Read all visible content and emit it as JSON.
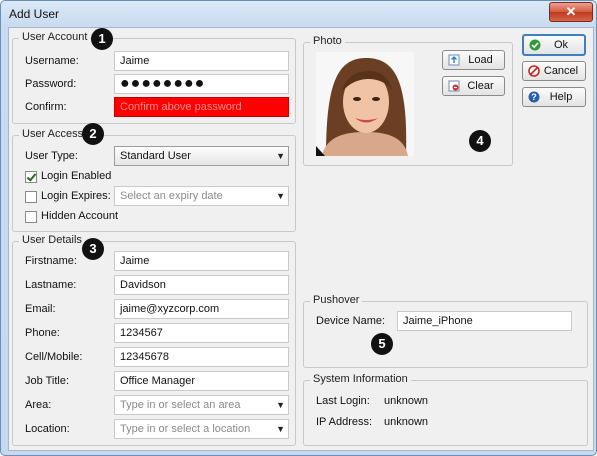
{
  "window": {
    "title": "Add User",
    "close_glyph": "✕"
  },
  "user_account": {
    "legend": "User Account",
    "username_label": "Username:",
    "username_value": "Jaime",
    "password_label": "Password:",
    "password_value": "●●●●●●●●",
    "confirm_label": "Confirm:",
    "confirm_value": "Confirm above password"
  },
  "user_access": {
    "legend": "User Access",
    "user_type_label": "User Type:",
    "user_type_value": "Standard User",
    "login_enabled_label": "Login Enabled",
    "login_enabled_checked": true,
    "login_expires_label": "Login Expires:",
    "login_expires_checked": false,
    "expiry_placeholder": "Select an expiry date",
    "hidden_account_label": "Hidden Account",
    "hidden_account_checked": false
  },
  "user_details": {
    "legend": "User Details",
    "firstname_label": "Firstname:",
    "firstname_value": "Jaime",
    "lastname_label": "Lastname:",
    "lastname_value": "Davidson",
    "email_label": "Email:",
    "email_value": "jaime@xyzcorp.com",
    "phone_label": "Phone:",
    "phone_value": "1234567",
    "mobile_label": "Cell/Mobile:",
    "mobile_value": "12345678",
    "jobtitle_label": "Job Title:",
    "jobtitle_value": "Office Manager",
    "area_label": "Area:",
    "area_placeholder": "Type in or select an area",
    "location_label": "Location:",
    "location_placeholder": "Type in or select a location"
  },
  "photo": {
    "legend": "Photo",
    "load_label": "Load",
    "clear_label": "Clear"
  },
  "pushover": {
    "legend": "Pushover",
    "device_label": "Device Name:",
    "device_value": "Jaime_iPhone"
  },
  "system_info": {
    "legend": "System Information",
    "last_login_label": "Last Login:",
    "last_login_value": "unknown",
    "ip_label": "IP Address:",
    "ip_value": "unknown"
  },
  "actions": {
    "ok_label": "Ok",
    "cancel_label": "Cancel",
    "help_label": "Help"
  },
  "badges": [
    "1",
    "2",
    "3",
    "4",
    "5"
  ],
  "colors": {
    "error_field": "#ff0000",
    "ok_accent": "#2e9a3a",
    "cancel_accent": "#c8261c",
    "help_accent": "#2a5fb0"
  }
}
